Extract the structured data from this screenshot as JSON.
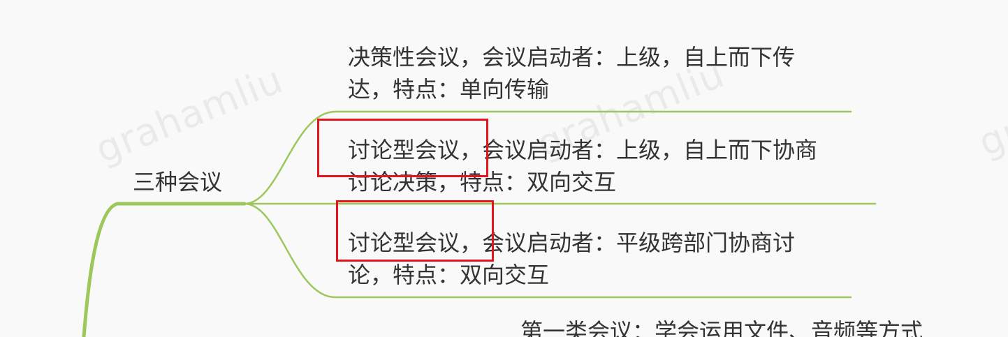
{
  "watermark": "grahamliu",
  "colors": {
    "branch_line": "#9dc75a",
    "highlight_box": "#e8141b",
    "text": "#333333",
    "background": "#f9f9f9"
  },
  "mindmap": {
    "topic": "三种会议",
    "children": [
      {
        "lines": [
          "决策性会议，会议启动者：上级，自上而下传",
          "达，特点：单向传输"
        ],
        "highlighted": false
      },
      {
        "lines": [
          "讨论型会议，会议启动者：上级，自上而下协商",
          "讨论决策，特点：双向交互"
        ],
        "highlighted": true
      },
      {
        "lines": [
          "讨论型会议，会议启动者：平级跨部门协商讨",
          "论，特点：双向交互"
        ],
        "highlighted": true
      }
    ],
    "next_topic_partial": "第一类会议：学会运用文件、音频等方式"
  }
}
